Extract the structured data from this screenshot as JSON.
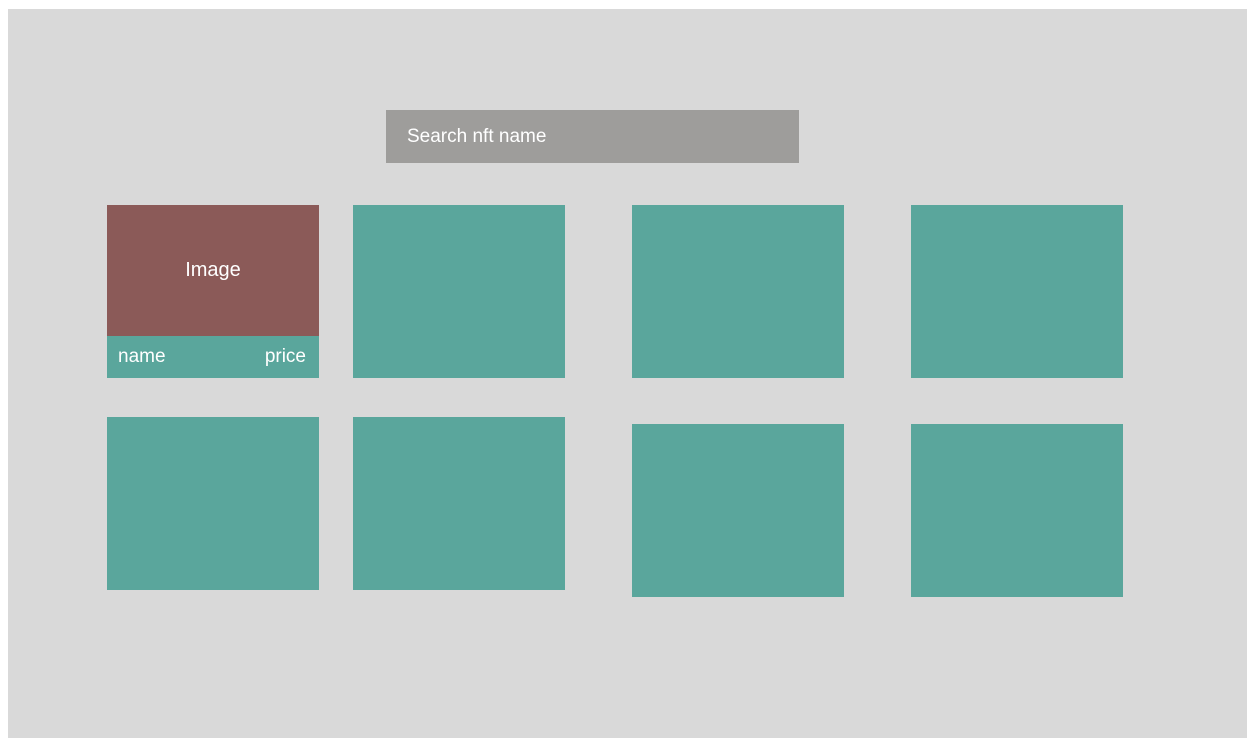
{
  "search": {
    "placeholder": "Search nft name"
  },
  "featured_card": {
    "image_label": "Image",
    "name_label": "name",
    "price_label": "price"
  },
  "colors": {
    "background": "#d9d9d9",
    "search_bar": "#9e9d9b",
    "card": "#5aa69c",
    "image_placeholder": "#8b5a58",
    "text": "#ffffff"
  }
}
